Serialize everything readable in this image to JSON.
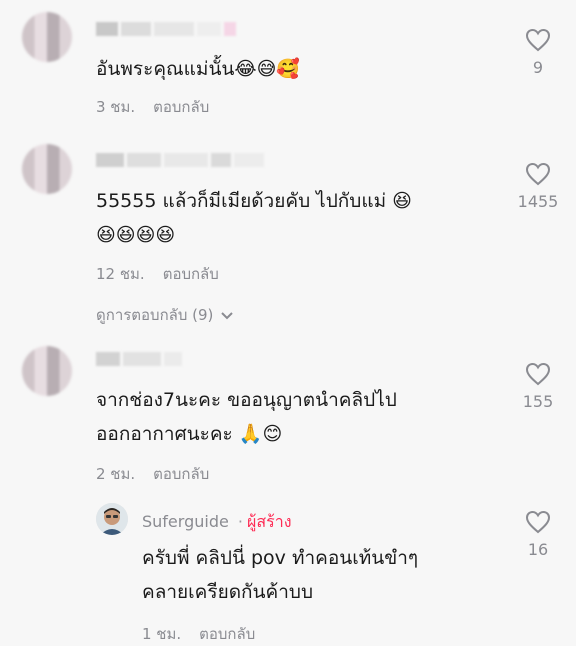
{
  "comments": [
    {
      "text_lines": [
        "อันพระคุณแม่นั้น😂😅🥰"
      ],
      "time": "3 ชม.",
      "reply_label": "ตอบกลับ",
      "likes": "9"
    },
    {
      "text_lines": [
        "55555 แล้วก็มีเมียด้วยคับ ไปกับแม่ 😆",
        "😆😆😆😆"
      ],
      "time": "12 ชม.",
      "reply_label": "ตอบกลับ",
      "likes": "1455",
      "view_replies": "ดูการตอบกลับ (9)"
    },
    {
      "text_lines": [
        "จากช่อง7นะคะ ขออนุญาตนำคลิปไป",
        "ออกอากาศนะคะ 🙏😊"
      ],
      "time": "2 ชม.",
      "reply_label": "ตอบกลับ",
      "likes": "155"
    }
  ],
  "creator_reply": {
    "username": "Suferguide",
    "separator": "·",
    "badge": "ผู้สร้าง",
    "text_lines": [
      "ครับพี่ คลิปนี่ pov ทำคอนเท้นขำๆ",
      "คลายเครียดกันค้าบบ"
    ],
    "time": "1 ชม.",
    "reply_label": "ตอบกลับ",
    "likes": "16"
  },
  "icons": {
    "like": "heart-outline-icon",
    "expand": "chevron-down-icon"
  },
  "colors": {
    "text": "#1b1b1b",
    "muted": "#8a8b91",
    "creator_badge": "#fe2c55",
    "background": "#f7f7f7"
  }
}
